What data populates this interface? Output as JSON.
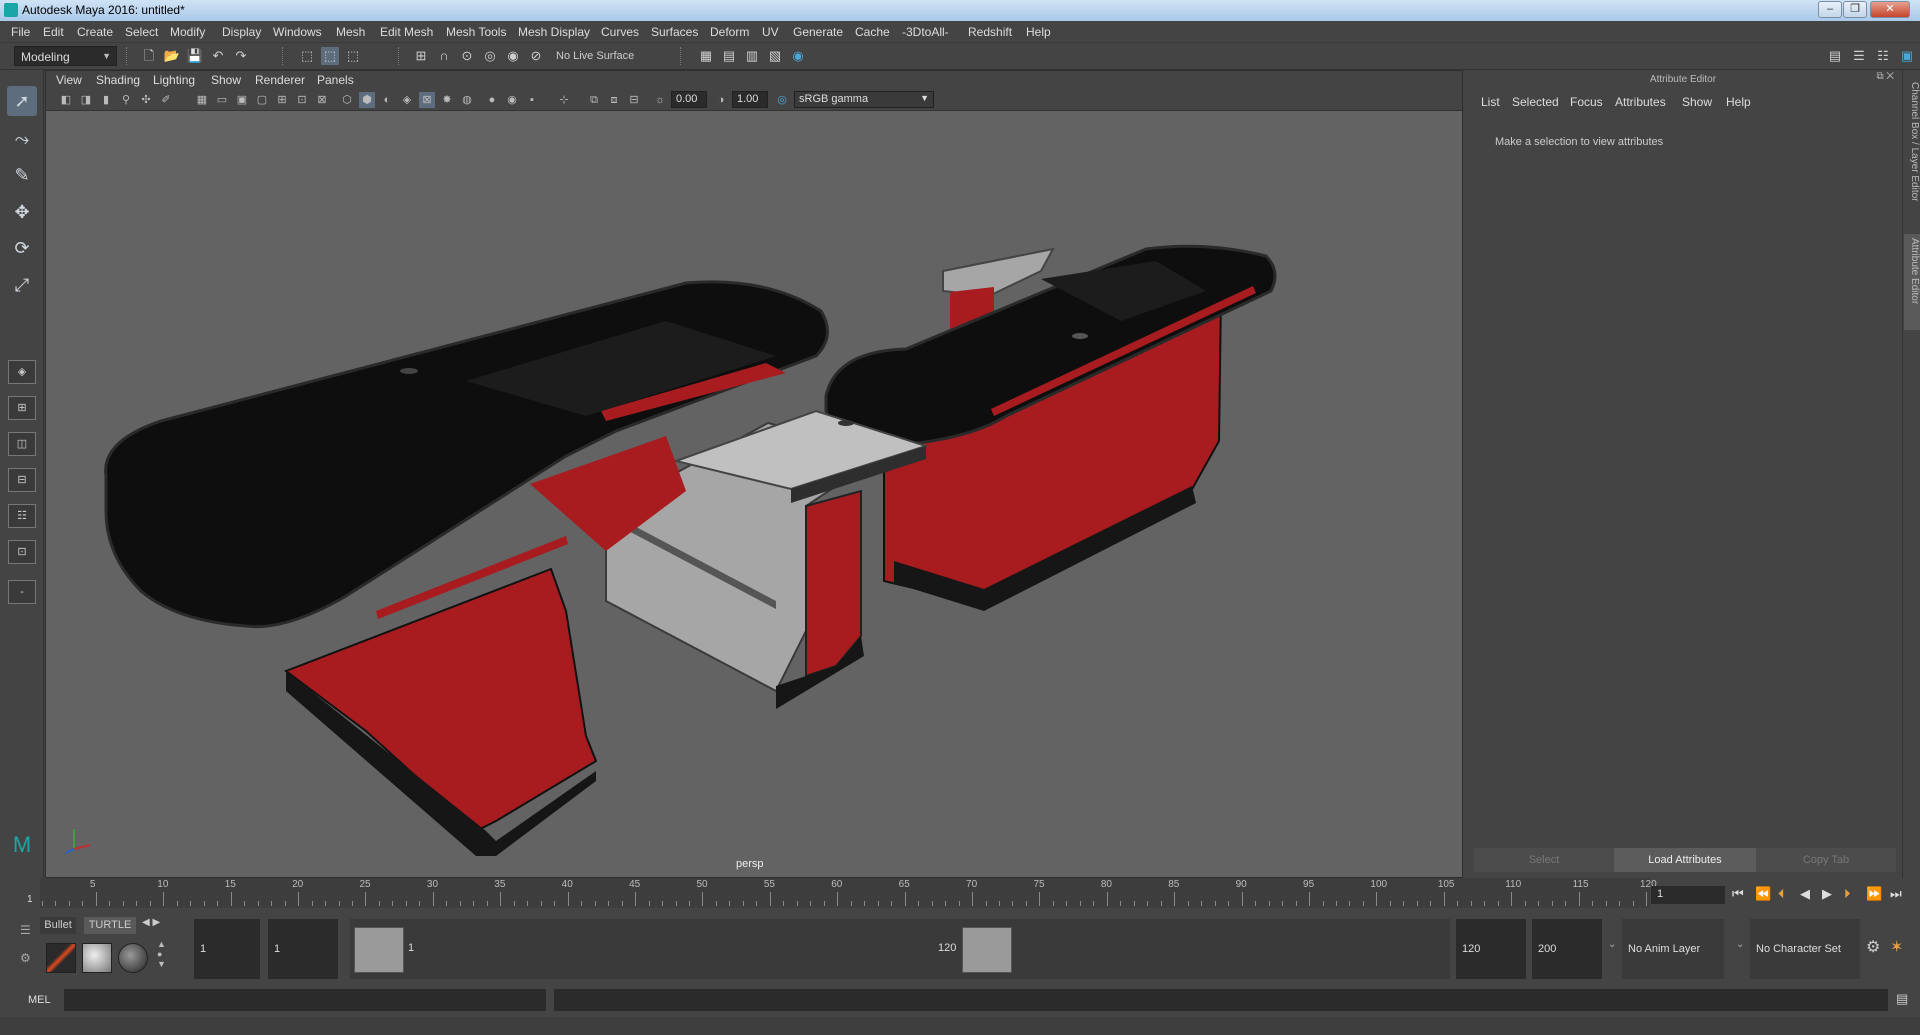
{
  "window": {
    "title": "Autodesk Maya 2016: untitled*"
  },
  "menubar": {
    "items": [
      "File",
      "Edit",
      "Create",
      "Select",
      "Modify",
      "Display",
      "Windows",
      "Mesh",
      "Edit Mesh",
      "Mesh Tools",
      "Mesh Display",
      "Curves",
      "Surfaces",
      "Deform",
      "UV",
      "Generate",
      "Cache",
      "-3DtoAll-",
      "Redshift",
      "Help"
    ]
  },
  "statusline": {
    "menuset": "Modeling",
    "live_surface": "No Live Surface"
  },
  "viewport": {
    "menu": [
      "View",
      "Shading",
      "Lighting",
      "Show",
      "Renderer",
      "Panels"
    ],
    "exposure": "0.00",
    "gamma": "1.00",
    "color_space": "sRGB gamma",
    "camera": "persp"
  },
  "attribute_editor": {
    "title": "Attribute Editor",
    "menu": [
      "List",
      "Selected",
      "Focus",
      "Attributes",
      "Show",
      "Help"
    ],
    "message": "Make a selection to view attributes",
    "buttons": {
      "select": "Select",
      "load": "Load Attributes",
      "copy": "Copy Tab"
    }
  },
  "side_tabs": {
    "channel_box": "Channel Box / Layer Editor",
    "attribute_editor": "Attribute Editor"
  },
  "time_slider": {
    "ticks": [
      "5",
      "10",
      "15",
      "20",
      "25",
      "30",
      "35",
      "40",
      "45",
      "50",
      "55",
      "60",
      "65",
      "70",
      "75",
      "80",
      "85",
      "90",
      "95",
      "100",
      "105",
      "110",
      "115",
      "120"
    ],
    "start_tick": "1",
    "current_frame": "1"
  },
  "range": {
    "start_field": "1",
    "start_field2": "1",
    "range_start": "1",
    "range_end": "120",
    "end_field": "120",
    "end_field2": "200",
    "anim_layer": "No Anim Layer",
    "char_set": "No Character Set"
  },
  "shelf": {
    "tabs": [
      "Bullet",
      "TURTLE"
    ]
  },
  "cmdline": {
    "language": "MEL"
  },
  "colors": {
    "counter_red": "#a81c20",
    "counter_black": "#0e0e0e",
    "counter_grey": "#a6a6a6",
    "viewport_bg": "#636363"
  }
}
